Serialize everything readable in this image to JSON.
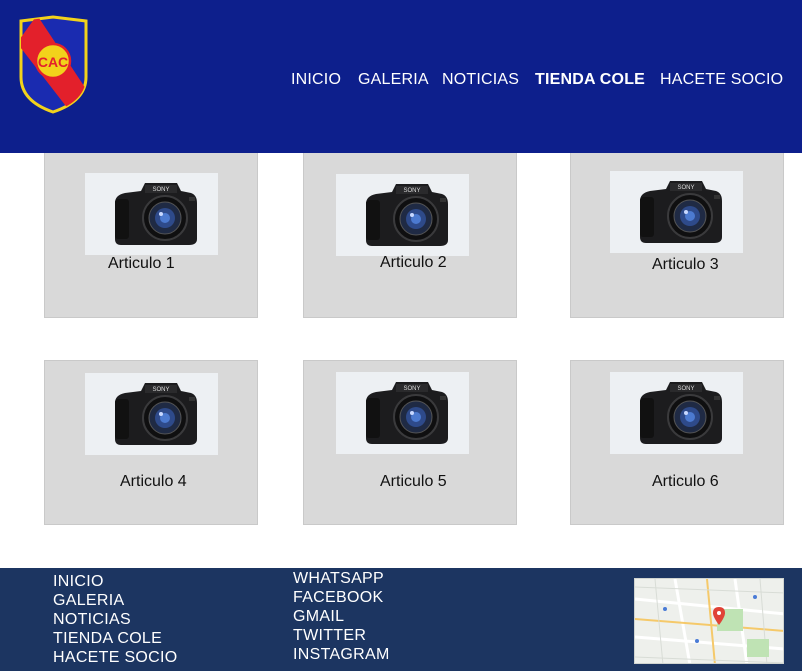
{
  "header": {
    "logo_letters": "CAC",
    "nav": [
      {
        "label": "INICIO",
        "active": false
      },
      {
        "label": "GALERIA",
        "active": false
      },
      {
        "label": "NOTICIAS",
        "active": false
      },
      {
        "label": "TIENDA COLE",
        "active": true
      },
      {
        "label": "HACETE SOCIO",
        "active": false
      }
    ],
    "colors": {
      "background": "#0d1f8c",
      "text": "#ffffff"
    }
  },
  "products": [
    {
      "label": "Articulo 1",
      "image": "camera-image"
    },
    {
      "label": "Articulo 2",
      "image": "camera-image"
    },
    {
      "label": "Articulo 3",
      "image": "camera-image"
    },
    {
      "label": "Articulo 4",
      "image": "camera-image"
    },
    {
      "label": "Articulo 5",
      "image": "camera-image"
    },
    {
      "label": "Articulo 6",
      "image": "camera-image"
    }
  ],
  "footer": {
    "nav_links": [
      "INICIO",
      "GALERIA",
      "NOTICIAS",
      "TIENDA COLE",
      "HACETE SOCIO"
    ],
    "social_links": [
      "WHATSAPP",
      "FACEBOOK",
      "GMAIL",
      "TWITTER",
      "INSTAGRAM"
    ],
    "map_image": "map-thumbnail",
    "colors": {
      "background": "#1c3561"
    }
  },
  "colors": {
    "card_background": "#d9d9d9"
  }
}
